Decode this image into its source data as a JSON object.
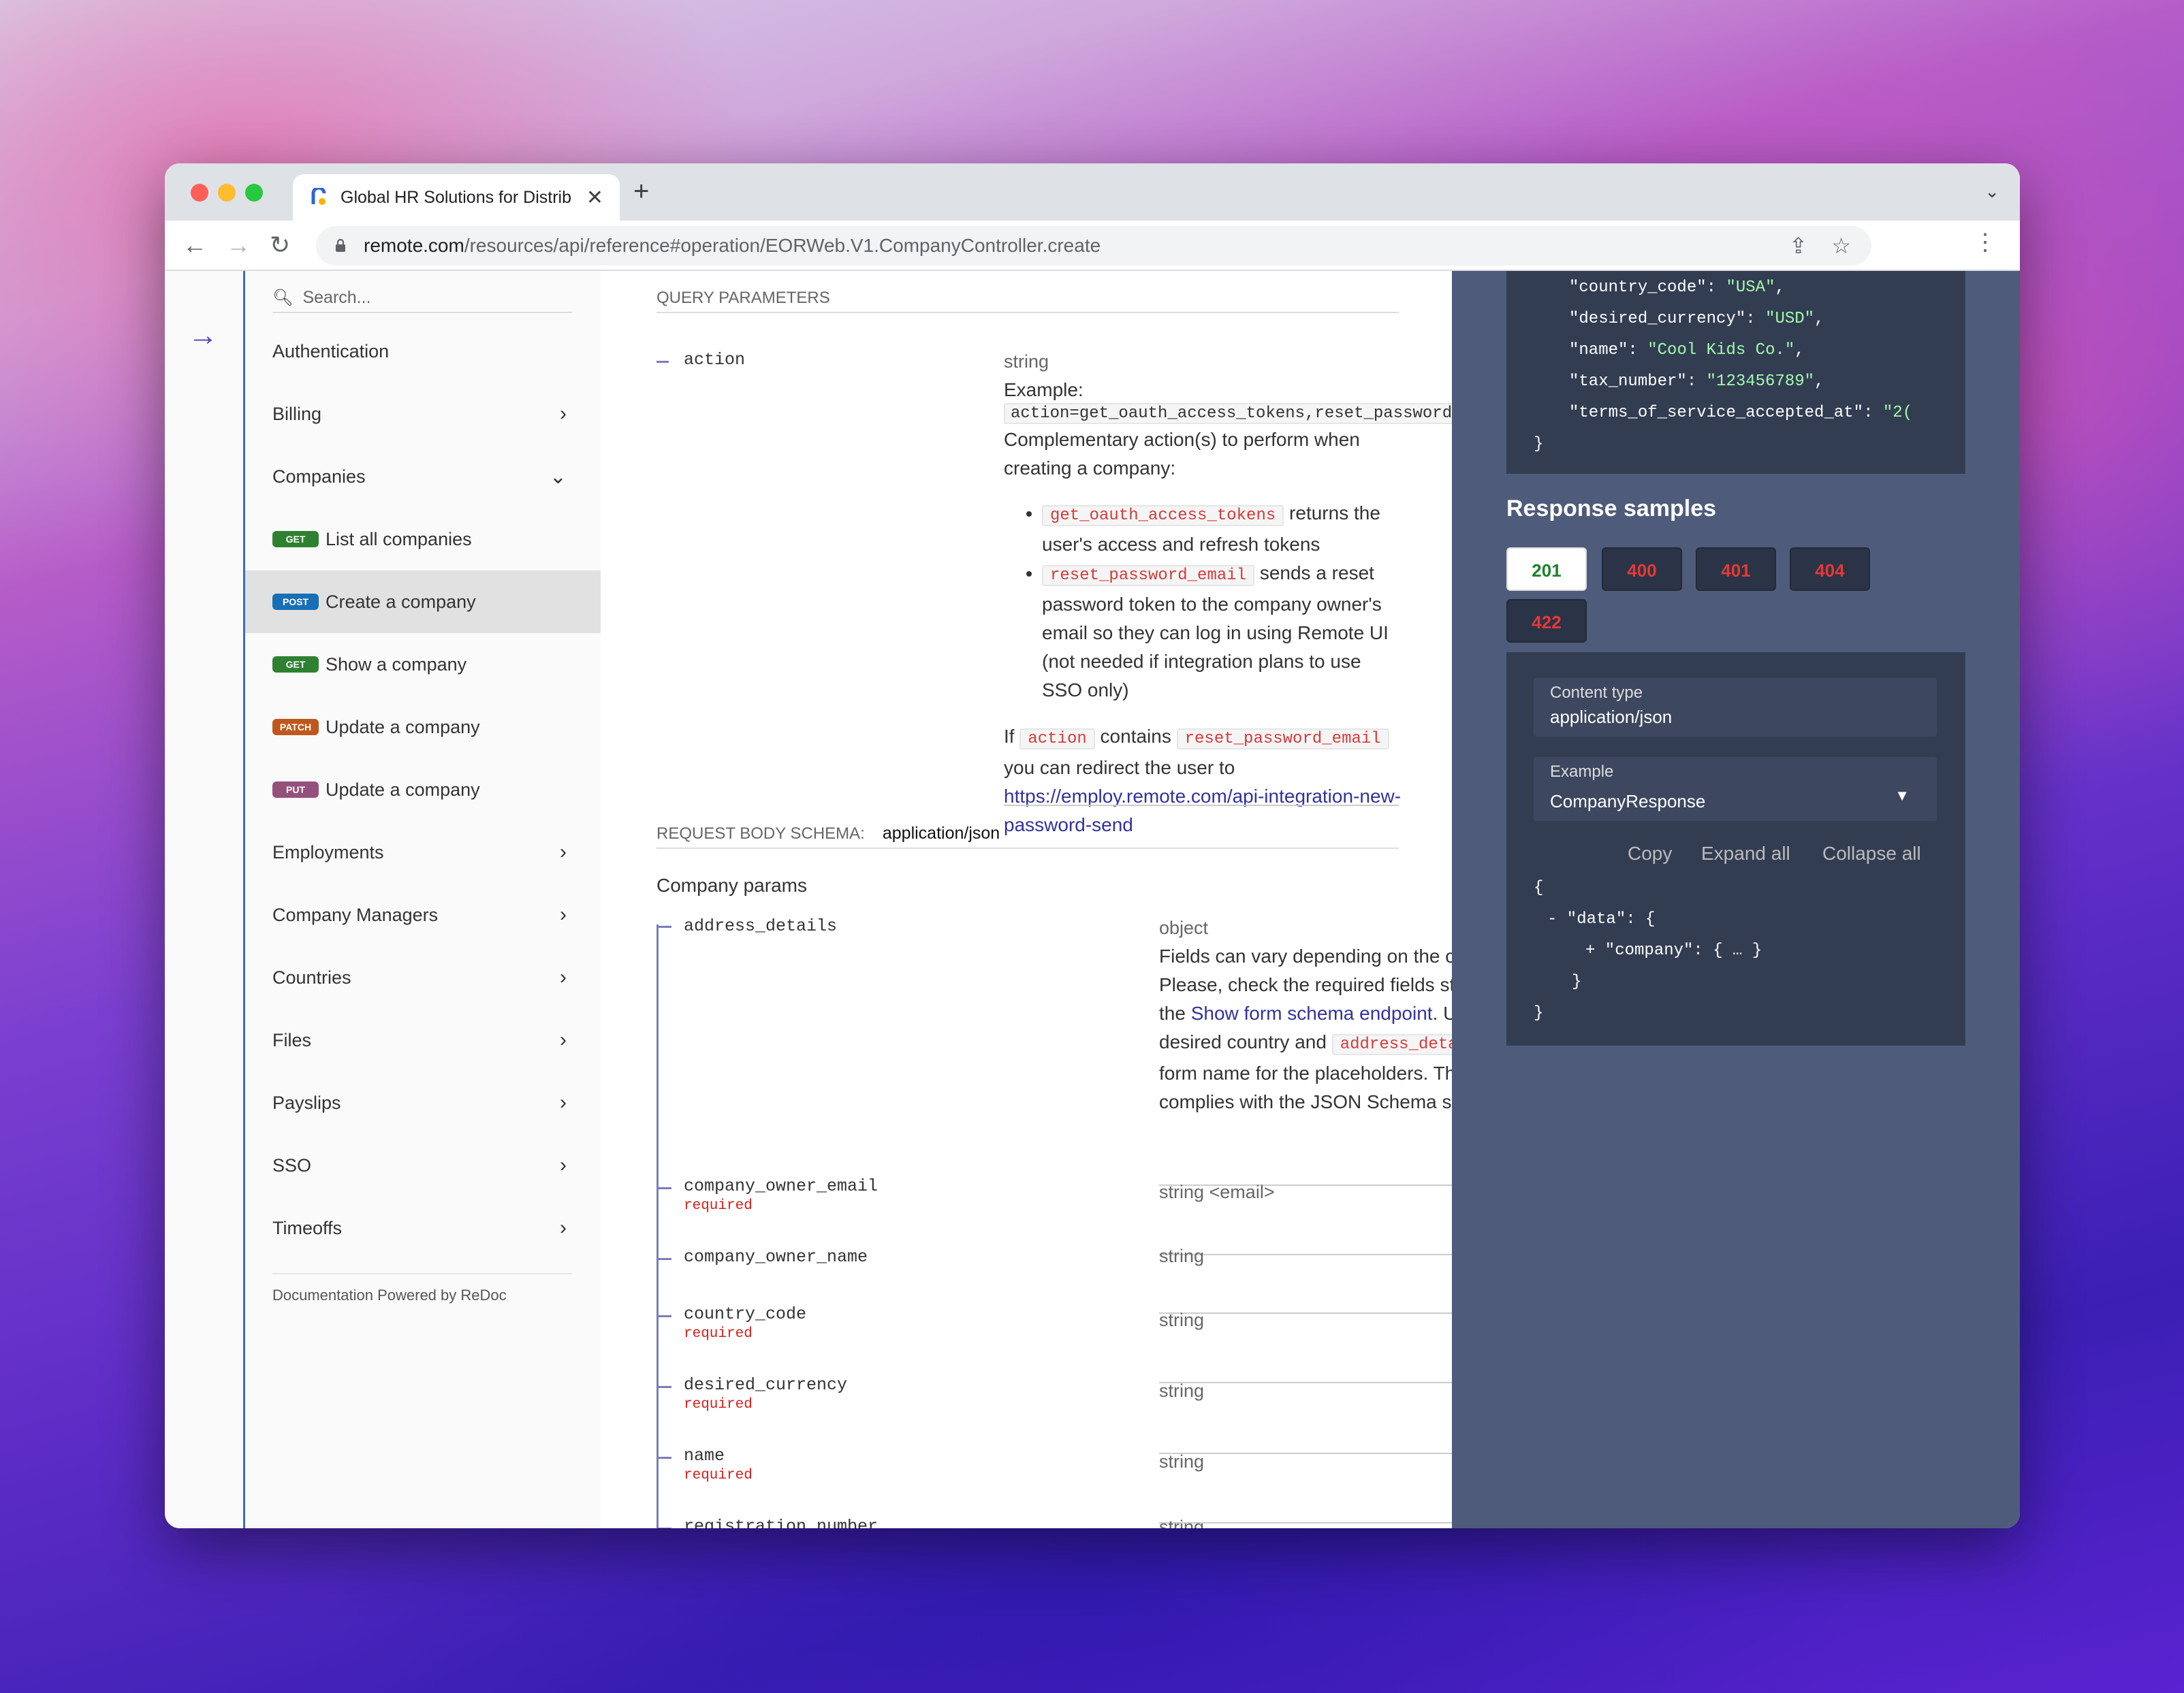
{
  "browser": {
    "tab_title": "Global HR Solutions for Distrib",
    "url_host": "remote.com",
    "url_path": "/resources/api/reference#operation/EORWeb.V1.CompanyController.create"
  },
  "sidebar": {
    "search_placeholder": "Search...",
    "items": [
      {
        "label": "Authentication",
        "chevron": ""
      },
      {
        "label": "Billing",
        "chevron": "›"
      },
      {
        "label": "Companies",
        "chevron": "⌄"
      },
      {
        "label": "List all companies",
        "badge": "GET"
      },
      {
        "label": "Create a company",
        "badge": "POST"
      },
      {
        "label": "Show a company",
        "badge": "GET"
      },
      {
        "label": "Update a company",
        "badge": "PATCH"
      },
      {
        "label": "Update a company",
        "badge": "PUT"
      },
      {
        "label": "Employments",
        "chevron": "›"
      },
      {
        "label": "Company Managers",
        "chevron": "›"
      },
      {
        "label": "Countries",
        "chevron": "›"
      },
      {
        "label": "Files",
        "chevron": "›"
      },
      {
        "label": "Payslips",
        "chevron": "›"
      },
      {
        "label": "SSO",
        "chevron": "›"
      },
      {
        "label": "Timeoffs",
        "chevron": "›"
      }
    ],
    "footer": "Documentation Powered by ReDoc"
  },
  "query": {
    "header": "QUERY PARAMETERS",
    "param_name": "action",
    "param_type": "string",
    "example_label": "Example:",
    "example_value": "action=get_oauth_access_tokens,reset_password_email",
    "desc": "Complementary action(s) to perform when creating a company:",
    "bullet1_code": "get_oauth_access_tokens",
    "bullet1_text": " returns the user's access and refresh tokens",
    "bullet2_code": "reset_password_email",
    "bullet2_text": " sends a reset password token to the company owner's email so they can log in using Remote UI (not needed if integration plans to use SSO only)",
    "if_text": "If ",
    "if_code1": "action",
    "contains": " contains ",
    "if_code2": "reset_password_email",
    "after": " you can redirect the user to ",
    "link": "https://employ.remote.com/api-integration-new-password-send"
  },
  "body": {
    "header": "REQUEST BODY SCHEMA:",
    "content_type": "application/json",
    "title": "Company params",
    "address": {
      "name": "address_details",
      "type": "object",
      "d1": "Fields can vary depending on the country. Please, check the required fields structure using the ",
      "link": "Show form schema endpoint",
      "d2": ". Use the desired country and ",
      "code": "address_details",
      "d3": " as the form name for the placeholders. The response complies with the JSON Schema specification."
    },
    "params": [
      {
        "name": "company_owner_email",
        "required": "required",
        "type": "string <email>"
      },
      {
        "name": "company_owner_name",
        "required": "",
        "type": "string"
      },
      {
        "name": "country_code",
        "required": "required",
        "type": "string"
      },
      {
        "name": "desired_currency",
        "required": "required",
        "type": "string"
      },
      {
        "name": "name",
        "required": "required",
        "type": "string"
      },
      {
        "name": "registration_number",
        "required": "",
        "type": "string"
      }
    ]
  },
  "request_sample": {
    "lines": [
      {
        "key": "\"country_code\"",
        "val": "\"USA\""
      },
      {
        "key": "\"desired_currency\"",
        "val": "\"USD\""
      },
      {
        "key": "\"name\"",
        "val": "\"Cool Kids Co.\""
      },
      {
        "key": "\"tax_number\"",
        "val": "\"123456789\""
      },
      {
        "key": "\"terms_of_service_accepted_at\"",
        "val": "\"2("
      }
    ],
    "close": "}"
  },
  "response": {
    "title": "Response samples",
    "codes": [
      "201",
      "400",
      "401",
      "404",
      "422"
    ],
    "content_type_label": "Content type",
    "content_type": "application/json",
    "example_label": "Example",
    "example_value": "CompanyResponse",
    "copy": "Copy",
    "expand": "Expand all",
    "collapse": "Collapse all",
    "json": [
      "{",
      "- \"data\": {",
      "+ \"company\": { … }",
      "}",
      "}"
    ]
  },
  "colors": {
    "accent": "#32329f",
    "get": "#2f8132",
    "post": "#186fb5",
    "patch": "#bf581d",
    "put": "#95507c",
    "error": "#e53935"
  }
}
